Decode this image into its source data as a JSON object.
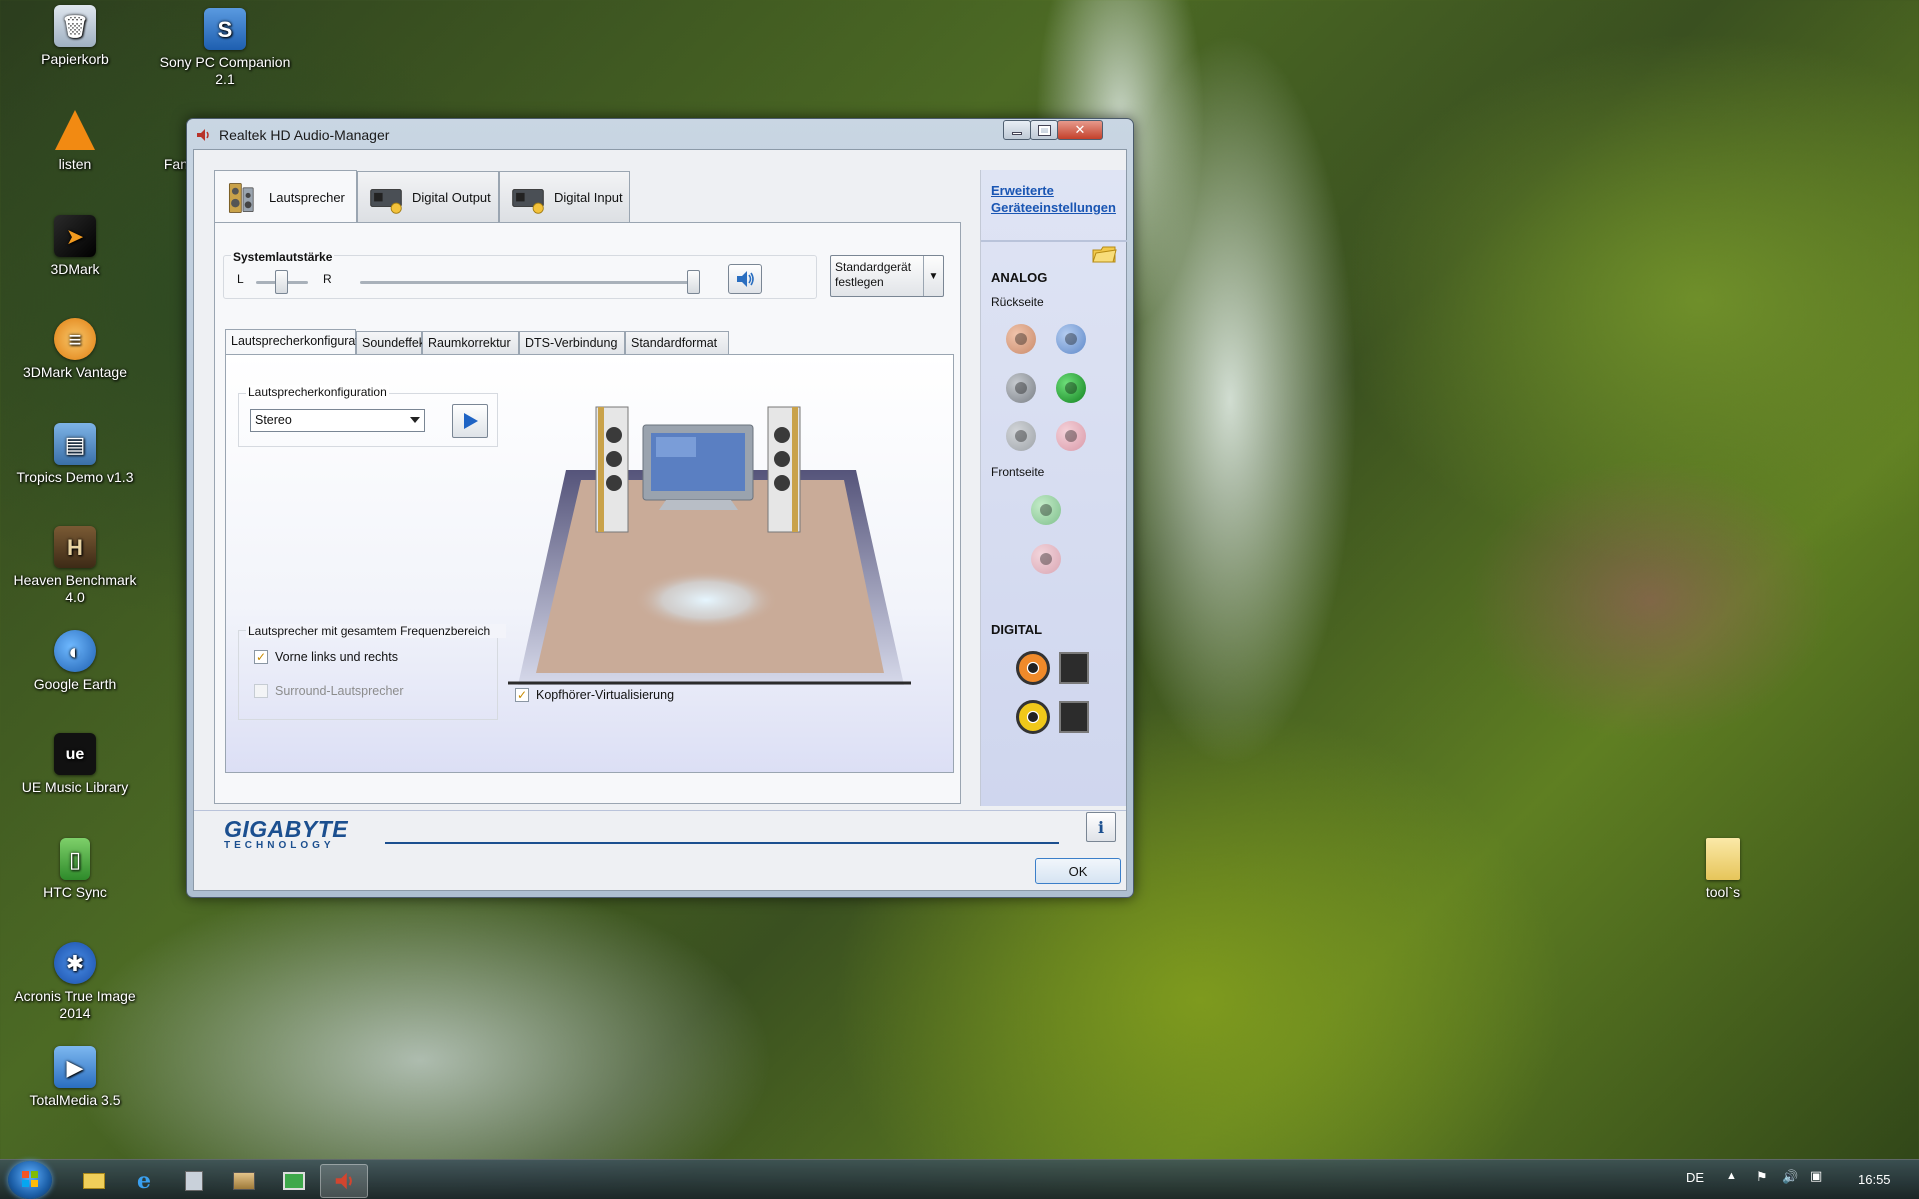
{
  "desktop": {
    "icons": [
      {
        "label": "Papierkorb",
        "icon": "recycle-bin-icon"
      },
      {
        "label": "Sony PC Companion 2.1",
        "icon": "sony-pc-companion-icon"
      },
      {
        "label": "listen",
        "icon": "vlc-icon"
      },
      {
        "label": "Fan",
        "icon": "partial-icon"
      },
      {
        "label": "3DMark",
        "icon": "3dmark-icon"
      },
      {
        "label": "3DMark Vantage",
        "icon": "3dmark-vantage-icon"
      },
      {
        "label": "Tropics Demo v1.3",
        "icon": "tropics-demo-icon"
      },
      {
        "label": "Heaven Benchmark 4.0",
        "icon": "heaven-benchmark-icon"
      },
      {
        "label": "Google Earth",
        "icon": "google-earth-icon"
      },
      {
        "label": "UE Music Library",
        "icon": "ue-music-library-icon"
      },
      {
        "label": "HTC Sync",
        "icon": "htc-sync-icon"
      },
      {
        "label": "Acronis True Image 2014",
        "icon": "acronis-icon"
      },
      {
        "label": "TotalMedia 3.5",
        "icon": "totalmedia-icon"
      },
      {
        "label": "tool`s",
        "icon": "folder-icon"
      }
    ]
  },
  "window": {
    "title": "Realtek HD Audio-Manager",
    "tabs": [
      {
        "label": "Lautsprecher",
        "active": true
      },
      {
        "label": "Digital Output",
        "active": false
      },
      {
        "label": "Digital Input",
        "active": false
      }
    ],
    "volume": {
      "label": "Systemlautstärke",
      "left": "L",
      "right": "R",
      "balance_level": 0.5,
      "volume_level": 1.0
    },
    "default_device_button": "Standardgerät festlegen",
    "subtabs": [
      {
        "label": "Lautsprecherkonfiguration",
        "active": true
      },
      {
        "label": "Soundeffekt",
        "active": false
      },
      {
        "label": "Raumkorrektur",
        "active": false
      },
      {
        "label": "DTS-Verbindung",
        "active": false
      },
      {
        "label": "Standardformat",
        "active": false
      }
    ],
    "speaker_config": {
      "group_label": "Lautsprecherkonfiguration",
      "selected": "Stereo"
    },
    "full_range": {
      "label": "Lautsprecher mit gesamtem Frequenzbereich",
      "front": {
        "label": "Vorne links und rechts",
        "checked": true
      },
      "surround": {
        "label": "Surround-Lautsprecher",
        "checked": false,
        "enabled": false
      }
    },
    "headphone_virtualization": {
      "label": "Kopfhörer-Virtualisierung",
      "checked": true
    },
    "right_pane": {
      "link": "Erweiterte Geräteeinstellungen",
      "analog_title": "ANALOG",
      "rear_label": "Rückseite",
      "front_label": "Frontseite",
      "digital_title": "DIGITAL",
      "colors": {
        "orange": "#c98a6a",
        "blue": "#5e88c9",
        "gray": "#8a8f96",
        "green": "#1f9a2c",
        "gray2": "#9ea3a8",
        "pink": "#d999a8",
        "front_green": "#7fbf8c",
        "front_pink": "#d9a5b2"
      }
    },
    "brand_top": "GIGABYTE",
    "brand_bottom": "TECHNOLOGY",
    "info_icon": "i",
    "ok_button": "OK"
  },
  "taskbar": {
    "language": "DE",
    "clock": "16:55"
  }
}
